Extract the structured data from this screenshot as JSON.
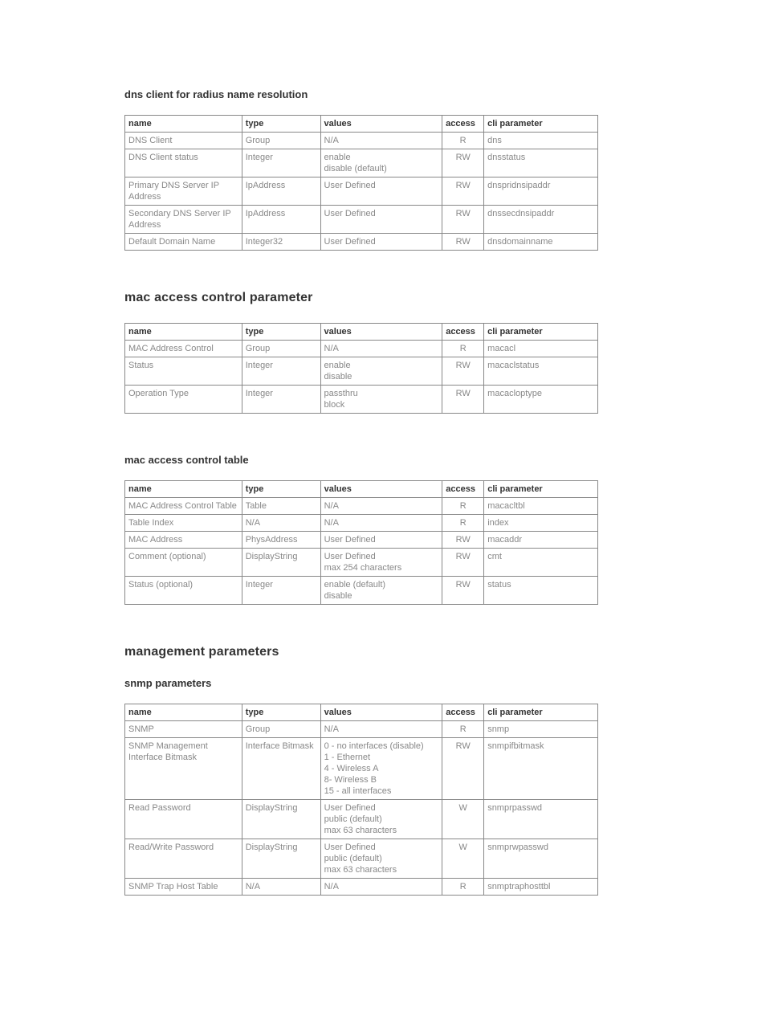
{
  "sections": [
    {
      "title": "dns client for radius name resolution",
      "level": "h3",
      "table": {
        "headers": {
          "name": "name",
          "type": "type",
          "values": "values",
          "access": "access",
          "cli": "cli parameter"
        },
        "rows": [
          {
            "name": "DNS Client",
            "type": "Group",
            "values": "N/A",
            "access": "R",
            "cli": "dns"
          },
          {
            "name": "DNS Client status",
            "type": "Integer",
            "values": "enable\ndisable (default)",
            "access": "RW",
            "cli": "dnsstatus"
          },
          {
            "name": "Primary DNS Server IP Address",
            "type": "IpAddress",
            "values": "User Defined",
            "access": "RW",
            "cli": "dnspridnsipaddr"
          },
          {
            "name": "Secondary DNS Server IP Address",
            "type": "IpAddress",
            "values": "User Defined",
            "access": "RW",
            "cli": "dnssecdnsipaddr"
          },
          {
            "name": "Default Domain Name",
            "type": "Integer32",
            "values": "User Defined",
            "access": "RW",
            "cli": "dnsdomainname"
          }
        ]
      }
    },
    {
      "title": "mac access control parameter",
      "level": "h2",
      "table": {
        "headers": {
          "name": "name",
          "type": "type",
          "values": "values",
          "access": "access",
          "cli": "cli parameter"
        },
        "rows": [
          {
            "name": "MAC Address Control",
            "type": "Group",
            "values": "N/A",
            "access": "R",
            "cli": "macacl"
          },
          {
            "name": "Status",
            "type": "Integer",
            "values": "enable\ndisable",
            "access": "RW",
            "cli": "macaclstatus"
          },
          {
            "name": "Operation Type",
            "type": "Integer",
            "values": "passthru\nblock",
            "access": "RW",
            "cli": "macacloptype"
          }
        ]
      }
    },
    {
      "title": "mac access control table",
      "level": "h3",
      "table": {
        "headers": {
          "name": "name",
          "type": "type",
          "values": "values",
          "access": "access",
          "cli": "cli parameter"
        },
        "rows": [
          {
            "name": "MAC Address Control Table",
            "type": "Table",
            "values": "N/A",
            "access": "R",
            "cli": "macacltbl"
          },
          {
            "name": "Table Index",
            "type": "N/A",
            "values": "N/A",
            "access": "R",
            "cli": "index"
          },
          {
            "name": "MAC Address",
            "type": "PhysAddress",
            "values": "User Defined",
            "access": "RW",
            "cli": "macaddr"
          },
          {
            "name": "Comment (optional)",
            "type": "DisplayString",
            "values": "User Defined\nmax 254 characters",
            "access": "RW",
            "cli": "cmt"
          },
          {
            "name": "Status (optional)",
            "type": "Integer",
            "values": "enable (default)\ndisable",
            "access": "RW",
            "cli": "status"
          }
        ]
      }
    },
    {
      "title": "management parameters",
      "level": "h2",
      "table": null
    },
    {
      "title": "snmp parameters",
      "level": "h3",
      "table": {
        "headers": {
          "name": "name",
          "type": "type",
          "values": "values",
          "access": "access",
          "cli": "cli parameter"
        },
        "rows": [
          {
            "name": "SNMP",
            "type": "Group",
            "values": "N/A",
            "access": "R",
            "cli": "snmp"
          },
          {
            "name": "SNMP Management Interface Bitmask",
            "type": "Interface Bitmask",
            "values": "0 - no interfaces (disable)\n1 - Ethernet\n4 - Wireless A\n8- Wireless B\n15 - all interfaces",
            "access": "RW",
            "cli": "snmpifbitmask"
          },
          {
            "name": "Read Password",
            "type": "DisplayString",
            "values": "User Defined\npublic (default)\nmax 63 characters",
            "access": "W",
            "cli": "snmprpasswd"
          },
          {
            "name": "Read/Write Password",
            "type": "DisplayString",
            "values": "User Defined\npublic (default)\nmax 63 characters",
            "access": "W",
            "cli": "snmprwpasswd"
          },
          {
            "name": "SNMP Trap Host Table",
            "type": "N/A",
            "values": "N/A",
            "access": "R",
            "cli": "snmptraphosttbl"
          }
        ]
      }
    }
  ]
}
